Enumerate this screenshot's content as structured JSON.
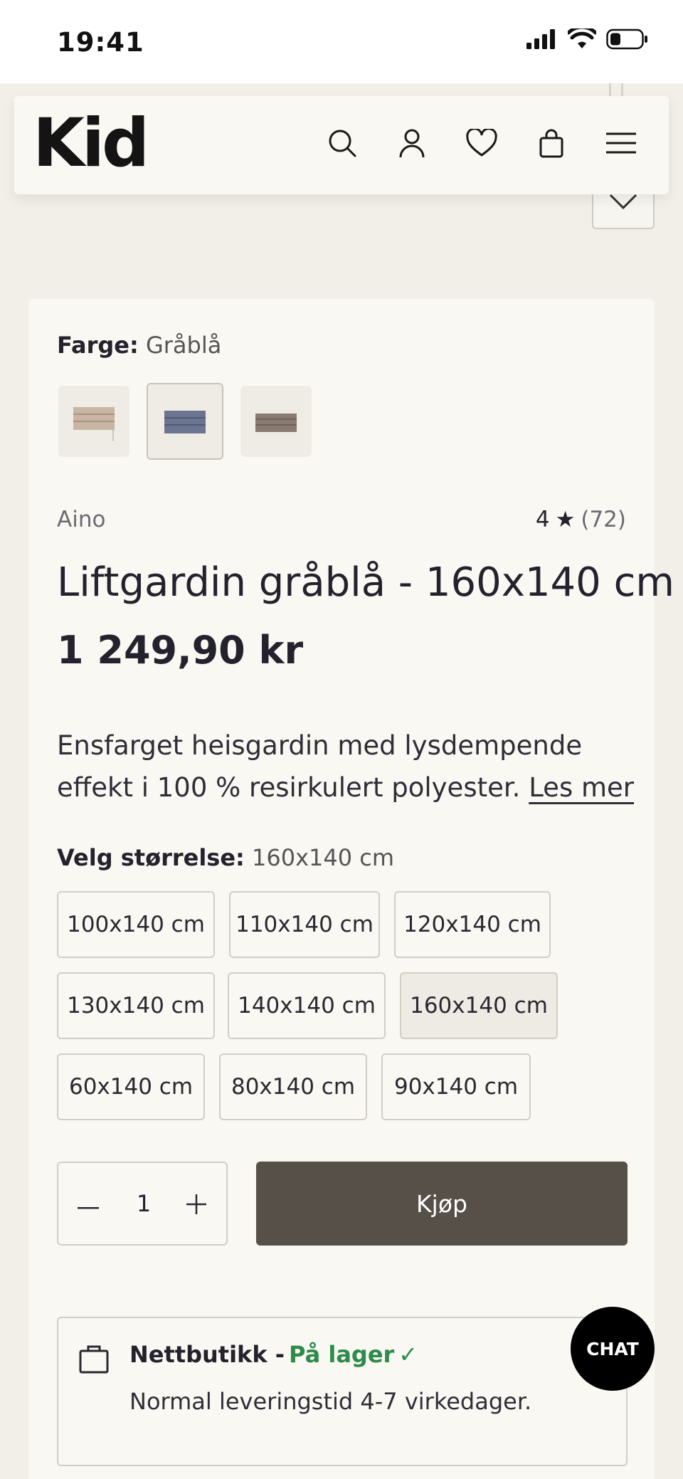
{
  "status_bar": {
    "time": "19:41"
  },
  "header": {
    "logo": "Kid",
    "icons": [
      "search-icon",
      "account-icon",
      "wishlist-heart-icon",
      "cart-bag-icon",
      "menu-hamburger-icon"
    ]
  },
  "product": {
    "color": {
      "label": "Farge:",
      "value": "Gråblå"
    },
    "swatches": [
      {
        "name": "beige",
        "color": "#c8b4a2"
      },
      {
        "name": "gråblå",
        "color": "#6e7890",
        "selected": true
      },
      {
        "name": "brun",
        "color": "#8a7a70"
      }
    ],
    "brand": "Aino",
    "rating": {
      "score": "4",
      "star": "★",
      "count": "(72)"
    },
    "title": "Liftgardin gråblå - 160x140 cm",
    "price": "1 249,90 kr",
    "description": "Ensfarget heisgardin med lysdempende effekt i 100 % resirkulert polyester.",
    "read_more": "Les mer"
  },
  "size": {
    "label": "Velg størrelse:",
    "selected": "160x140 cm",
    "options": [
      "100x140 cm",
      "110x140 cm",
      "120x140 cm",
      "130x140 cm",
      "140x140 cm",
      "160x140 cm",
      "60x140 cm",
      "80x140 cm",
      "90x140 cm"
    ]
  },
  "purchase": {
    "quantity": "1",
    "buy_label": "Kjøp"
  },
  "stock": {
    "store": "Nettbutikk -",
    "status": "På lager",
    "check": "✓",
    "delivery": "Normal leveringstid 4-7 virkedager."
  },
  "chat": {
    "label": "CHAT"
  },
  "colors": {
    "accent_dark": "#575048",
    "in_stock": "#2e8b4a",
    "background": "#f2efe8",
    "card": "#faf8f3"
  }
}
